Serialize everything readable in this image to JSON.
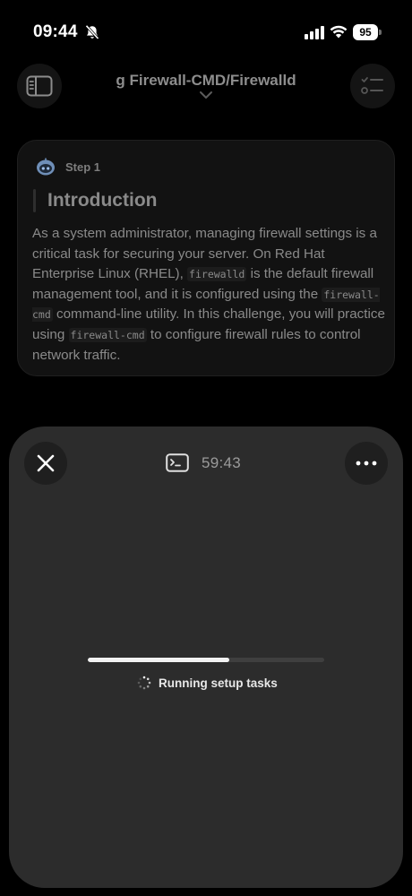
{
  "status_bar": {
    "time": "09:44",
    "battery": "95"
  },
  "header": {
    "title": "g Firewall-CMD/Firewalld"
  },
  "step_card": {
    "step_label": "Step 1",
    "heading": "Introduction",
    "paragraph": [
      {
        "t": "As a system administrator, managing firewall settings is a critical task for securing your server. On Red Hat Enterprise Linux (RHEL), "
      },
      {
        "c": "firewalld"
      },
      {
        "t": " is the default firewall management tool, and it is configured using the "
      },
      {
        "c": "firewall-cmd"
      },
      {
        "t": " command-line utility. In this challenge, you will practice using "
      },
      {
        "c": "firewall-cmd"
      },
      {
        "t": " to configure firewall rules to control network traffic."
      }
    ]
  },
  "terminal_sheet": {
    "timer": "59:43",
    "progress_percent": 60,
    "status_text": "Running setup tasks"
  },
  "colors": {
    "background": "#000000",
    "sheet": "#2c2c2c",
    "progress_fill": "#f2f2f2",
    "step_icon_accent": "#6f8fb8"
  },
  "icons": {
    "status": [
      "bell-slash-icon",
      "cellular-signal-icon",
      "wifi-icon",
      "battery-icon"
    ],
    "header_left": "sidebar-toggle-icon",
    "header_right": "checklist-icon",
    "header_chevron": "chevron-down-icon",
    "step": "robot-icon",
    "sheet_close": "close-icon",
    "sheet_more": "more-horizontal-icon",
    "terminal": "terminal-icon",
    "spinner": "spinner-icon"
  }
}
